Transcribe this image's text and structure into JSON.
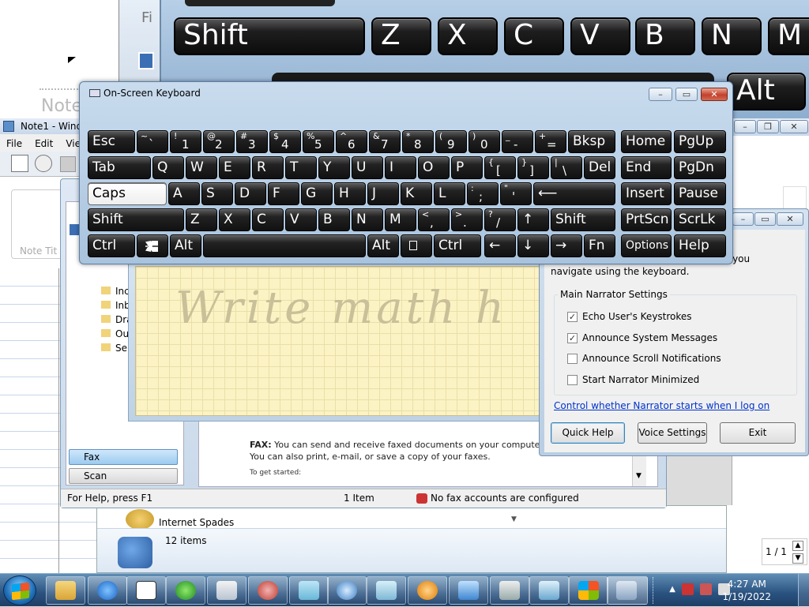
{
  "background": {
    "big_keys": [
      "Shift",
      "Z",
      "X",
      "C",
      "V",
      "B",
      "N",
      "M",
      "Alt"
    ],
    "note_label": "Note",
    "fi_label": "Fi"
  },
  "notes_window": {
    "title": "Note1 - Windo",
    "menu": [
      "File",
      "Edit",
      "View"
    ],
    "note_title_placeholder": "Note Tit"
  },
  "fax_window": {
    "folders": [
      "Inc",
      "Inb",
      "Dra",
      "Ou",
      "Ser"
    ],
    "bottom_tabs": [
      "Fax",
      "Scan"
    ],
    "fax_text_bold": "FAX:",
    "fax_text": "You can send and receive faxed documents on your computer without u machine. You can also print, e-mail, or save a copy of your faxes.",
    "to_get_started": "To get started:",
    "status_left": "For Help, press F1",
    "status_mid": "1 Item",
    "status_right": "No fax accounts are configured"
  },
  "math_panel": {
    "watermark": "Write math h"
  },
  "games_window": {
    "item_label": "Internet Spades",
    "items_count": "12 items"
  },
  "narrator": {
    "intro_text": "navigate using the keyboard.",
    "intro_tail": "s you",
    "group_label": "Main Narrator Settings",
    "options": [
      {
        "label": "Echo User's Keystrokes",
        "checked": true
      },
      {
        "label": "Announce System Messages",
        "checked": true
      },
      {
        "label": "Announce Scroll Notifications",
        "checked": false
      },
      {
        "label": "Start Narrator Minimized",
        "checked": false
      }
    ],
    "link": "Control whether Narrator starts when I log on",
    "buttons": {
      "quick_help": "Quick Help",
      "voice_settings": "Voice Settings",
      "exit": "Exit"
    }
  },
  "osk": {
    "title": "On-Screen Keyboard",
    "row1_main": [
      "Esc",
      "Bksp",
      "Home",
      "PgUp"
    ],
    "row1_digits": [
      {
        "sup": "~",
        "main": "`"
      },
      {
        "sup": "!",
        "main": "1"
      },
      {
        "sup": "@",
        "main": "2"
      },
      {
        "sup": "#",
        "main": "3"
      },
      {
        "sup": "$",
        "main": "4"
      },
      {
        "sup": "%",
        "main": "5"
      },
      {
        "sup": "^",
        "main": "6"
      },
      {
        "sup": "&",
        "main": "7"
      },
      {
        "sup": "*",
        "main": "8"
      },
      {
        "sup": "(",
        "main": "9"
      },
      {
        "sup": ")",
        "main": "0"
      },
      {
        "sup": "_",
        "main": "-"
      },
      {
        "sup": "+",
        "main": "="
      }
    ],
    "row2": [
      "Tab",
      "Q",
      "W",
      "E",
      "R",
      "T",
      "Y",
      "U",
      "I",
      "O",
      "P",
      "Del",
      "End",
      "PgDn"
    ],
    "row2_brackets": [
      {
        "sup": "{",
        "main": "["
      },
      {
        "sup": "}",
        "main": "]"
      },
      {
        "sup": "|",
        "main": "\\"
      }
    ],
    "row3": [
      "Caps",
      "A",
      "S",
      "D",
      "F",
      "G",
      "H",
      "J",
      "K",
      "L",
      "Insert",
      "Pause"
    ],
    "row3_punct": [
      {
        "sup": ":",
        "main": ";"
      },
      {
        "sup": "\"",
        "main": "'"
      }
    ],
    "enter_glyph": "⟵",
    "row4": [
      "Shift",
      "Z",
      "X",
      "C",
      "V",
      "B",
      "N",
      "M",
      "Shift",
      "PrtScn",
      "ScrLk"
    ],
    "row4_punct": [
      {
        "sup": "<",
        "main": ","
      },
      {
        "sup": ">",
        "main": "."
      },
      {
        "sup": "?",
        "main": "/"
      }
    ],
    "up_arrow": "↑",
    "row5": [
      "Ctrl",
      "Alt",
      "Alt",
      "Ctrl",
      "Fn",
      "Options",
      "Help"
    ],
    "arrows": [
      "←",
      "↓",
      "→"
    ]
  },
  "page_indicator": "1 / 1",
  "clock": {
    "time": "4:27 AM",
    "date": "1/19/2022"
  }
}
